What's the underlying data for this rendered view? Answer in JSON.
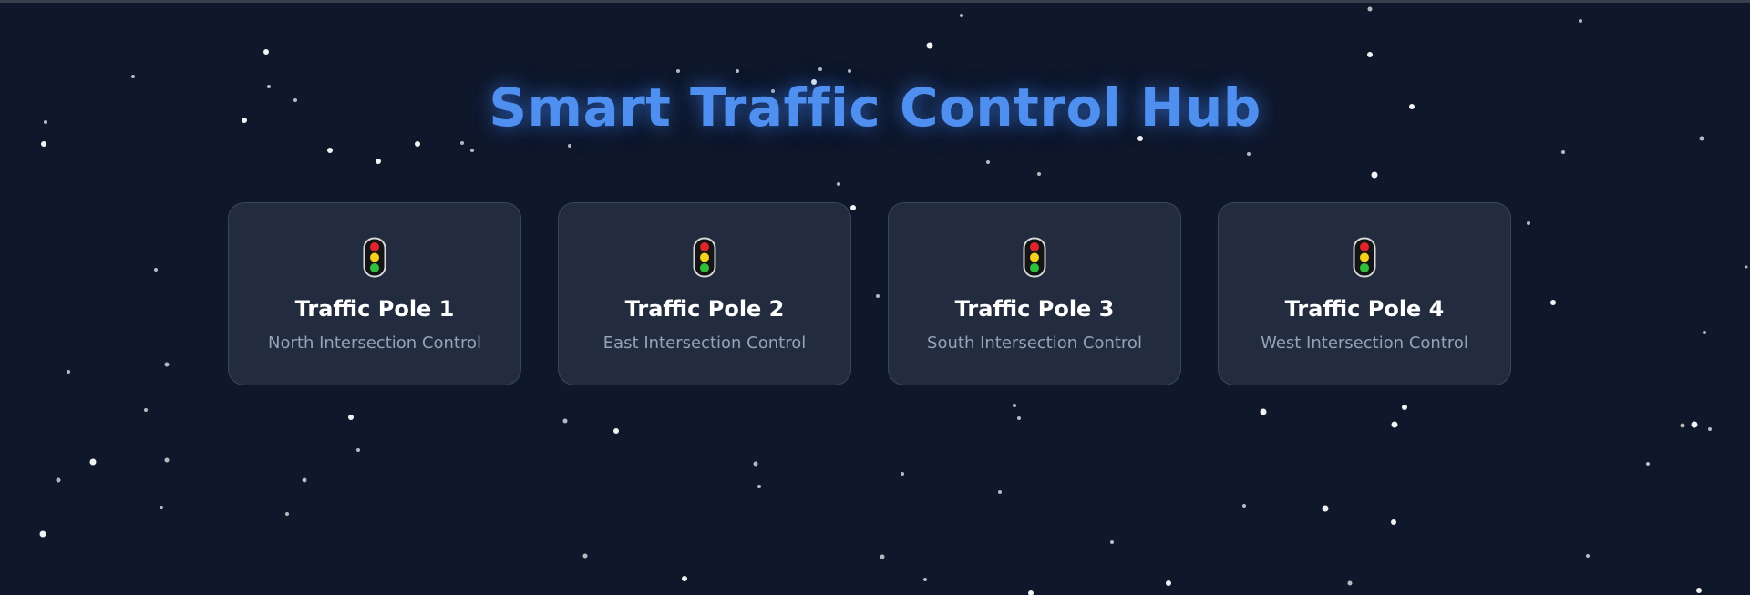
{
  "page": {
    "title": "Smart Traffic Control Hub"
  },
  "colors": {
    "background": "#0f172a",
    "accent": "#4f8ff0",
    "card": "#222c3e",
    "muted_text": "#94a3b8"
  },
  "cards": [
    {
      "icon": "traffic-light-icon",
      "title": "Traffic Pole 1",
      "subtitle": "North Intersection Control"
    },
    {
      "icon": "traffic-light-icon",
      "title": "Traffic Pole 2",
      "subtitle": "East Intersection Control"
    },
    {
      "icon": "traffic-light-icon",
      "title": "Traffic Pole 3",
      "subtitle": "South Intersection Control"
    },
    {
      "icon": "traffic-light-icon",
      "title": "Traffic Pole 4",
      "subtitle": "West Intersection Control"
    }
  ]
}
